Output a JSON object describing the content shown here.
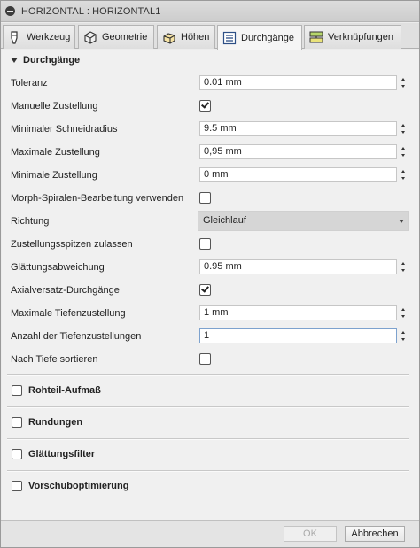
{
  "window": {
    "title": "HORIZONTAL : HORIZONTAL1"
  },
  "tabs": [
    {
      "label": "Werkzeug",
      "icon": "tool-icon"
    },
    {
      "label": "Geometrie",
      "icon": "geometry-icon"
    },
    {
      "label": "Höhen",
      "icon": "heights-icon"
    },
    {
      "label": "Durchgänge",
      "icon": "passes-icon",
      "active": true
    },
    {
      "label": "Verknüpfungen",
      "icon": "linking-icon"
    }
  ],
  "section": {
    "title": "Durchgänge"
  },
  "fields": {
    "toleranz": {
      "label": "Toleranz",
      "value": "0.01 mm"
    },
    "manuelle_zustellung": {
      "label": "Manuelle Zustellung",
      "checked": true
    },
    "min_schneidradius": {
      "label": "Minimaler Schneidradius",
      "value": "9.5 mm"
    },
    "max_zustellung": {
      "label": "Maximale Zustellung",
      "value": "0,95 mm"
    },
    "min_zustellung": {
      "label": "Minimale Zustellung",
      "value": "0 mm"
    },
    "morph_spiralen": {
      "label": "Morph-Spiralen-Bearbeitung verwenden",
      "checked": false
    },
    "richtung": {
      "label": "Richtung",
      "value": "Gleichlauf"
    },
    "zustellungsspitzen": {
      "label": "Zustellungsspitzen zulassen",
      "checked": false
    },
    "glaettungsabweichung": {
      "label": "Glättungsabweichung",
      "value": "0.95 mm"
    },
    "axialversatz": {
      "label": "Axialversatz-Durchgänge",
      "checked": true
    },
    "max_tiefenzustellung": {
      "label": "Maximale Tiefenzustellung",
      "value": "1 mm"
    },
    "anzahl_tiefenzustellungen": {
      "label": "Anzahl der Tiefenzustellungen",
      "value": "1"
    },
    "nach_tiefe": {
      "label": "Nach Tiefe sortieren",
      "checked": false
    }
  },
  "collapsed_sections": [
    {
      "label": "Rohteil-Aufmaß"
    },
    {
      "label": "Rundungen"
    },
    {
      "label": "Glättungsfilter"
    },
    {
      "label": "Vorschuboptimierung"
    }
  ],
  "footer": {
    "ok_label": "OK",
    "cancel_label": "Abbrechen"
  }
}
